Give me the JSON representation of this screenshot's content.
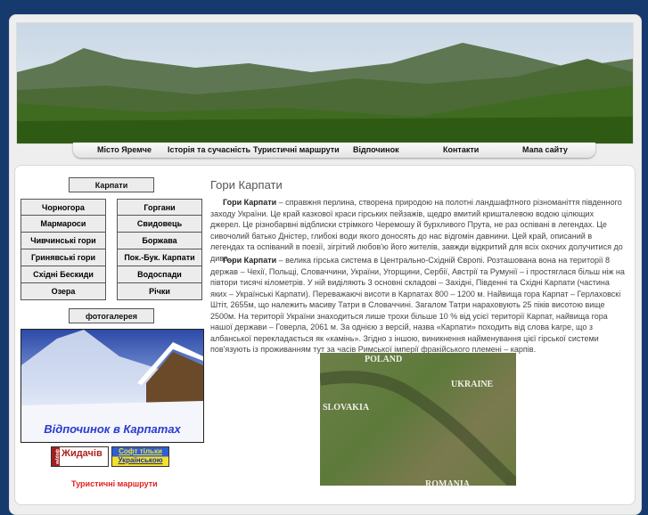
{
  "nav": [
    "Місто Яремче",
    "Історія та сучасність",
    "Туристичні маршрути",
    "Відпочинок",
    "Контакти",
    "Мапа сайту"
  ],
  "sidebar": {
    "top": "Карпати",
    "left": [
      "Чорногора",
      "Мармароси",
      "Чивчинські гори",
      "Гринявські гори",
      "Східні Бескиди",
      "Озера"
    ],
    "right": [
      "Горгани",
      "Свидовець",
      "Боржава",
      "Пок.-Бук. Карпати",
      "Водоспади",
      "Річки"
    ],
    "gallery": "фотогалерея",
    "promo": "Відпочинок в Карпатах",
    "badge1": "Жидачів",
    "badge1_side": "форум",
    "badge2_line1": "Софт тільки",
    "badge2_line2": "Українською",
    "routes": "Туристичні маршрути"
  },
  "main": {
    "title": "Гори Карпати",
    "p1_bold": "Гори Карпати",
    "p1": " – справжня перлина, створена природою на полотні ландшафтного різноманіття південного заходу України. Це край казкової краси гірських пейзажів, щедро вмитий кришталевою водою цілющих джерел. Це різнобарвні відблиски стрімкого Черемошу й бурхливого Прута, не раз оспівані в легендах. Це сивочолий батько Дністер, глибокі води якого доносять до нас відгомін давнини. Цей край, описаний в легендах та оспіваний в поезії, зігрітий любов'ю його жителів, завжди відкритий для всіх охочих долучитися до дива...",
    "p2_bold": "Гори Карпати",
    "p2": " – велика гірська система в Центрально-Східній Європі. Розташована вона на території 8 держав – Чехії, Польщі, Словаччини, України, Угорщини, Сербії, Австрії та Румунії – і простяглася більш ніж на півтори тисячі кілометрів. У ній виділяють 3 основні складові – Західні, Південні та Східні Карпати (частина яких – Українські Карпати). Переважаючі висоти в Карпатах 800 – 1200 м. Найвища гора Карпат – Герлаховскі Штіт, 2655м, що належить масиву Татри в Словаччині. Загалом Татри нараховують 25 піків висотою вище 2500м. На території України знаходиться лише трохи більше 10 % від усієї території Карпат, найвища гора нашої держави – Говерла, 2061 м. За однією з версій, назва «Карпати» походить від слова karpe, що з албанської перекладається як «камінь». Згідно з іншою, виникнення найменування цієї гірської системи пов'язують із проживанням тут за часів Римської імперії фракійського племені – карпів.",
    "map_labels": [
      "POLAND",
      "UKRAINE",
      "SLOVAKIA",
      "ROMANIA"
    ]
  }
}
